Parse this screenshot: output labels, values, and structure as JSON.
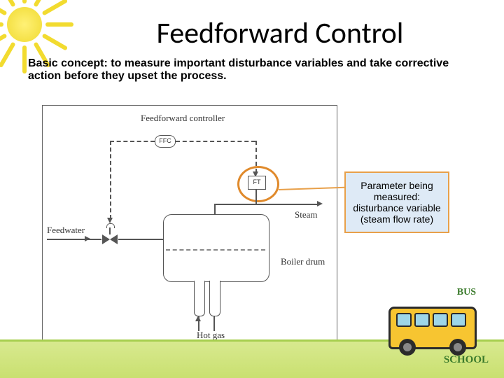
{
  "title": "Feedforward Control",
  "description_lead": "Basic concept:",
  "description_body": " to measure important disturbance variables and take corrective action before they upset the process.",
  "diagram": {
    "controller_label": "Feedforward controller",
    "ffc_tag": "FFC",
    "ft_tag": "FT",
    "feedwater_label": "Feedwater",
    "steam_label": "Steam",
    "boiler_label": "Boiler drum",
    "hotgas_label": "Hot gas"
  },
  "callout": "Parameter being measured: disturbance variable (steam flow rate)",
  "bus": {
    "sign1": "BUS",
    "sign2": "SCHOOL"
  }
}
